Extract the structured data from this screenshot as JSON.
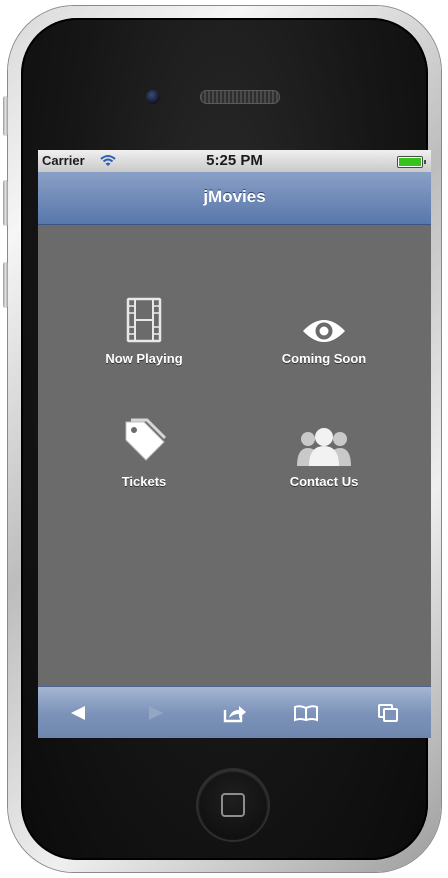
{
  "status_bar": {
    "carrier": "Carrier",
    "time": "5:25 PM",
    "wifi_icon": "wifi-icon",
    "battery_icon": "battery-icon"
  },
  "app": {
    "title": "jMovies"
  },
  "menu": [
    {
      "label": "Now Playing",
      "icon": "film-icon"
    },
    {
      "label": "Coming Soon",
      "icon": "eye-icon"
    },
    {
      "label": "Tickets",
      "icon": "tag-icon"
    },
    {
      "label": "Contact Us",
      "icon": "people-icon"
    }
  ],
  "toolbar": {
    "buttons": [
      "back-arrow-icon",
      "forward-arrow-icon",
      "share-icon",
      "bookmarks-icon",
      "tabs-icon"
    ]
  },
  "colors": {
    "screen_bg": "#6b6b6b",
    "header": "#5877ab",
    "toolbar": "#7d93b9",
    "text": "#ffffff"
  }
}
